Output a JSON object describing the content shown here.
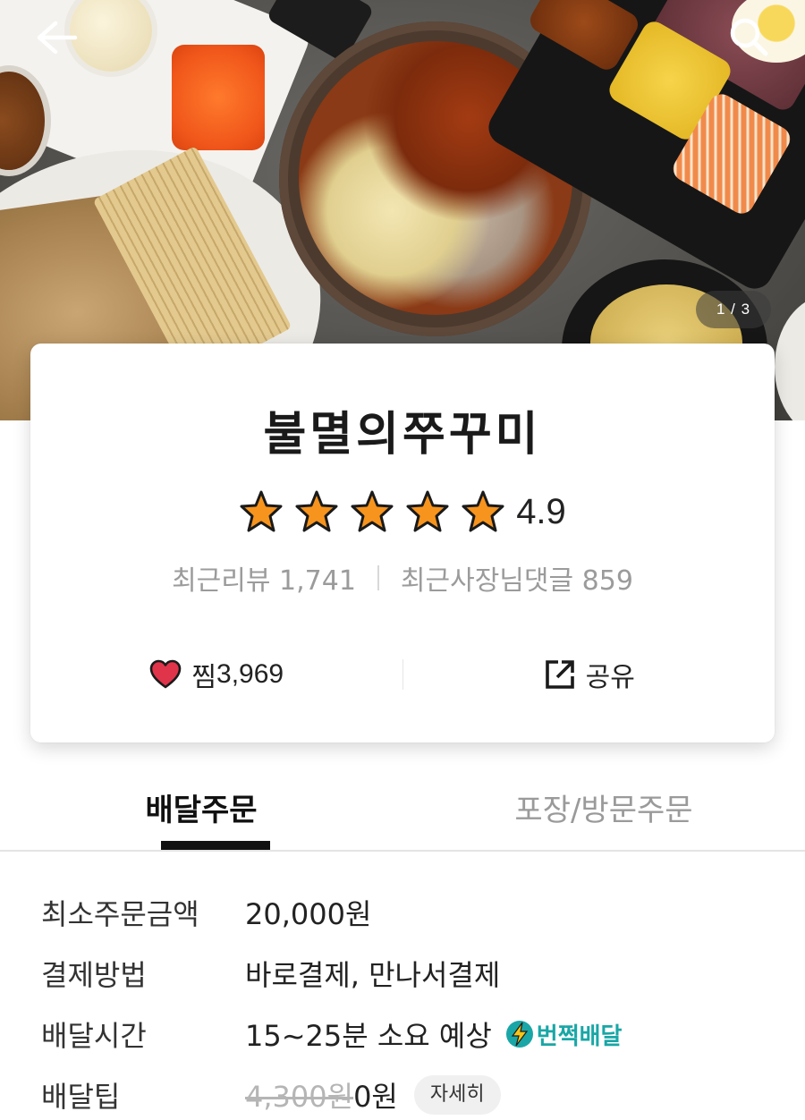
{
  "hero": {
    "page_indicator": "1 / 3",
    "back_icon": "arrow-left-icon",
    "search_icon": "search-icon"
  },
  "store": {
    "name": "불멸의쭈꾸미",
    "rating": "4.9",
    "rating_stars": 5,
    "recent_reviews_label": "최근리뷰",
    "recent_reviews": "1,741",
    "owner_replies_label": "최근사장님댓글",
    "owner_replies": "859",
    "like_label": "찜",
    "like_count": "3,969",
    "share_label": "공유"
  },
  "tabs": [
    {
      "label": "배달주문",
      "active": true
    },
    {
      "label": "포장/방문주문",
      "active": false
    }
  ],
  "info": {
    "min_order_label": "최소주문금액",
    "min_order_value": "20,000원",
    "payment_label": "결제방법",
    "payment_value": "바로결제, 만나서결제",
    "delivery_time_label": "배달시간",
    "delivery_time_value": "15~25분 소요 예상",
    "express_badge": "번쩍배달",
    "delivery_tip_label": "배달팁",
    "delivery_tip_original": "4,300원",
    "delivery_tip_value": "0원",
    "detail_button": "자세히"
  },
  "colors": {
    "star_fill": "#f7941d",
    "heart": "#e0344a",
    "express_teal": "#1aa6a6",
    "express_bolt": "#f5c518"
  }
}
